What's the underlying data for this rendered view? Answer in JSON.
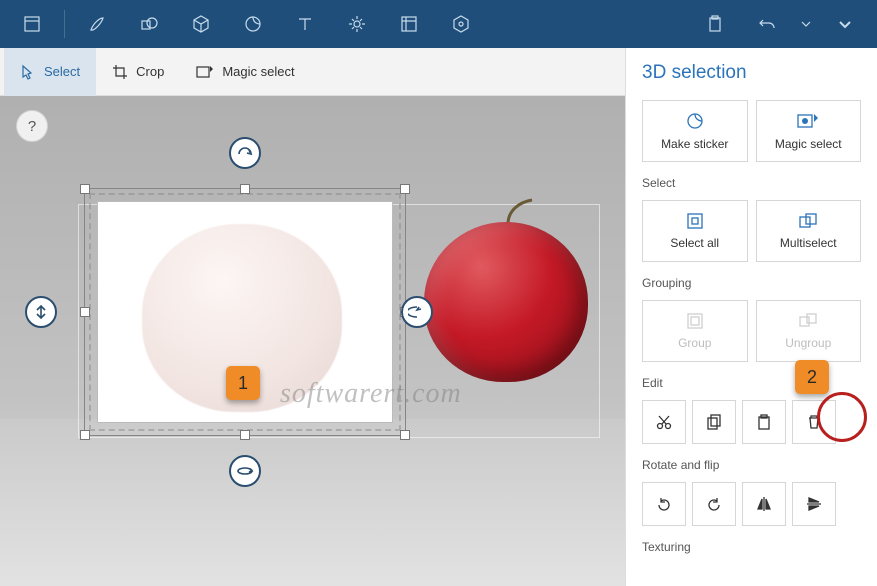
{
  "sub_toolbar": {
    "select_label": "Select",
    "crop_label": "Crop",
    "magic_select_label": "Magic select"
  },
  "panel": {
    "title": "3D selection",
    "make_sticker": "Make sticker",
    "magic_select": "Magic select",
    "section_select": "Select",
    "select_all": "Select all",
    "multiselect": "Multiselect",
    "section_grouping": "Grouping",
    "group": "Group",
    "ungroup": "Ungroup",
    "section_edit": "Edit",
    "section_rotate_flip": "Rotate and flip",
    "section_texturing": "Texturing"
  },
  "callouts": {
    "one": "1",
    "two": "2"
  },
  "watermark": "softwarert.com",
  "help": "?"
}
